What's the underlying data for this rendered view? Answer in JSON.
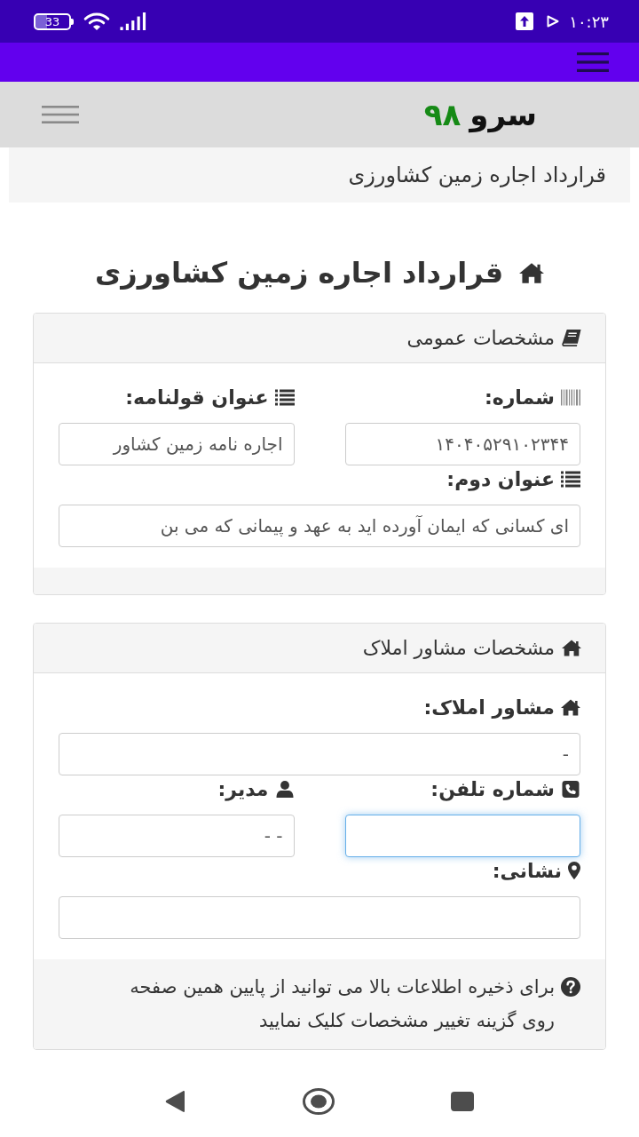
{
  "status_bar": {
    "battery": "33",
    "time": "۱۰:۲۳"
  },
  "header": {
    "logo_name": "سرو",
    "logo_number": "۹۸"
  },
  "breadcrumb": {
    "label": "قرارداد اجاره زمین کشاورزی"
  },
  "page_title": "قرارداد اجاره زمین کشاورزی",
  "general_card": {
    "title": "مشخصات عمومی",
    "number": {
      "label": "شماره:",
      "value": "۱۴۰۴۰۵۲۹۱۰۲۳۴۴",
      "focused": false
    },
    "deed_title": {
      "label": "عنوان قولنامه:",
      "value": "اجاره نامه زمین کشاور",
      "focused": false
    },
    "second_title": {
      "label": "عنوان دوم:",
      "value": "ای کسانی که ایمان آورده اید به عهد و پیمانی که می بن",
      "focused": false
    }
  },
  "agency_card": {
    "title": "مشخصات مشاور املاک",
    "agency": {
      "label": "مشاور املاک:",
      "value": "-",
      "focused": false
    },
    "phone": {
      "label": "شماره تلفن:",
      "focused": true
    },
    "manager": {
      "label": "مدیر:",
      "value": "- -",
      "focused": false
    },
    "address": {
      "label": "نشانی:",
      "focused": false
    },
    "note": "برای ذخیره اطلاعات بالا می توانید از پایین همین صفحه روی گزینه تغییر مشخصات کلیک نمایید"
  }
}
